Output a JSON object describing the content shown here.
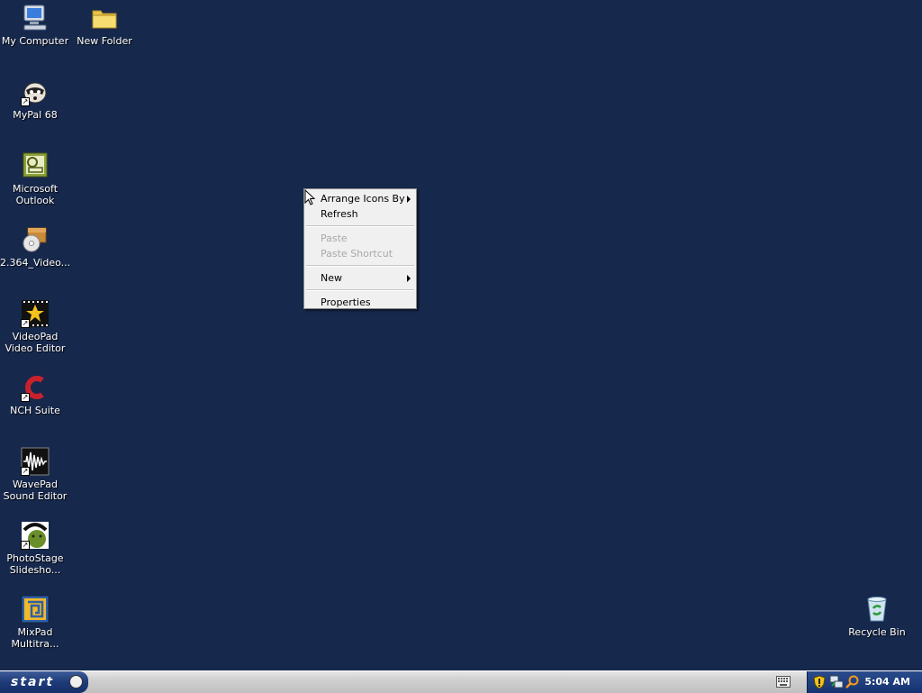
{
  "desktop": {
    "icons": [
      {
        "label": "My Computer",
        "icon": "my-computer-icon"
      },
      {
        "label": "New Folder",
        "icon": "folder-icon"
      },
      {
        "label": "MyPal 68",
        "icon": "mypal-icon"
      },
      {
        "label": "Microsoft Outlook",
        "icon": "outlook-icon"
      },
      {
        "label": "2.364_Video...",
        "icon": "cd-installer-icon"
      },
      {
        "label": "VideoPad Video Editor",
        "icon": "videopad-icon"
      },
      {
        "label": "NCH Suite",
        "icon": "nch-suite-icon"
      },
      {
        "label": "WavePad Sound Editor",
        "icon": "wavepad-icon"
      },
      {
        "label": "PhotoStage Slidesho...",
        "icon": "photostage-icon"
      },
      {
        "label": "MixPad Multitra...",
        "icon": "mixpad-icon"
      },
      {
        "label": "Recycle Bin",
        "icon": "recycle-bin-icon"
      }
    ]
  },
  "context_menu": {
    "items": [
      {
        "label": "Arrange Icons By",
        "submenu": true,
        "enabled": true
      },
      {
        "label": "Refresh",
        "submenu": false,
        "enabled": true
      },
      {
        "label": "Paste",
        "submenu": false,
        "enabled": false
      },
      {
        "label": "Paste Shortcut",
        "submenu": false,
        "enabled": false
      },
      {
        "label": "New",
        "submenu": true,
        "enabled": true
      },
      {
        "label": "Properties",
        "submenu": false,
        "enabled": true
      }
    ]
  },
  "taskbar": {
    "start_label": "start",
    "clock": "5:04 AM"
  },
  "colors": {
    "desktop_background": "#16284c",
    "taskbar": "#cfcfcf",
    "start_button": "#1e3a78",
    "tray": "#163270"
  }
}
